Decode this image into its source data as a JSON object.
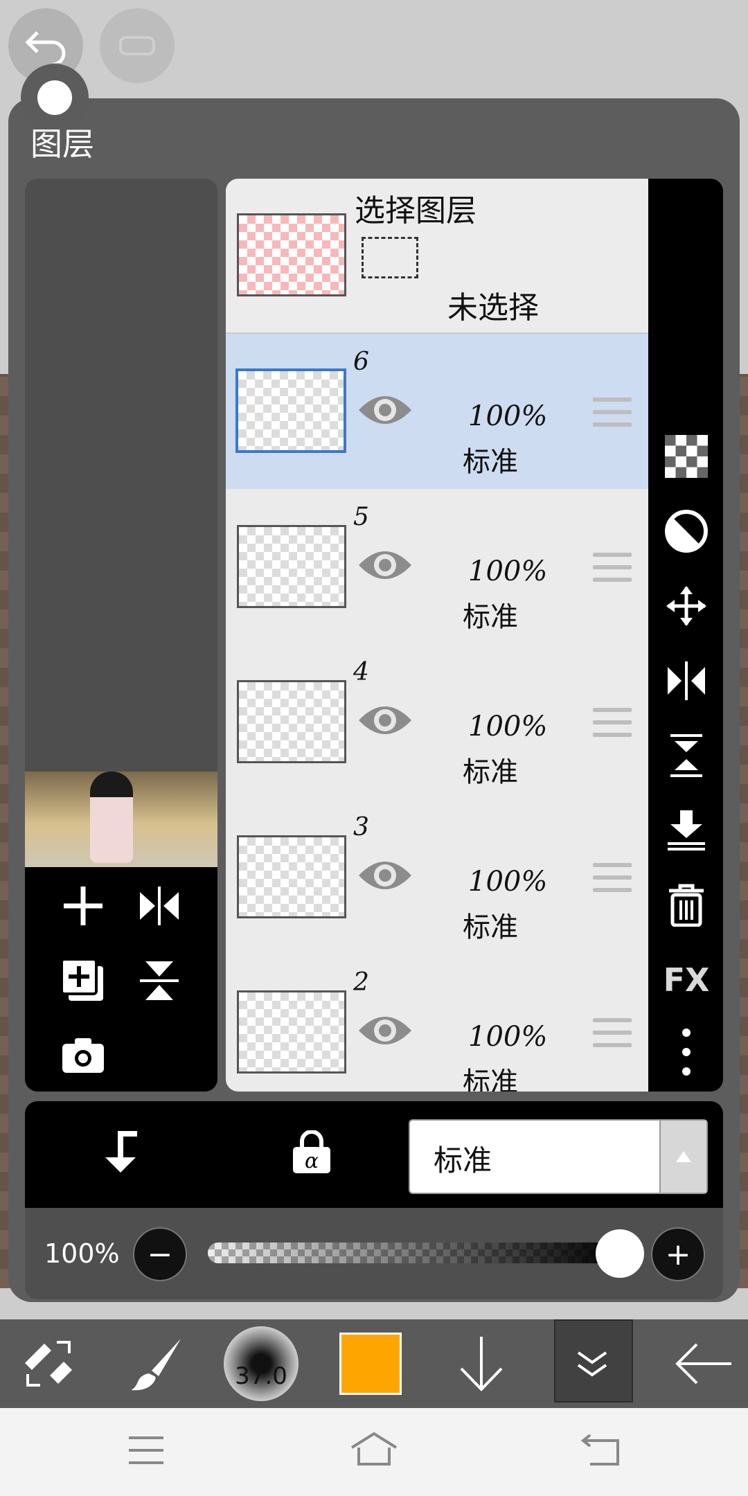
{
  "panel": {
    "title": "图层"
  },
  "selection_row": {
    "title": "选择图层",
    "status": "未选择"
  },
  "layers": [
    {
      "number": "6",
      "opacity": "100%",
      "blend": "标准",
      "selected": true
    },
    {
      "number": "5",
      "opacity": "100%",
      "blend": "标准",
      "selected": false
    },
    {
      "number": "4",
      "opacity": "100%",
      "blend": "标准",
      "selected": false
    },
    {
      "number": "3",
      "opacity": "100%",
      "blend": "标准",
      "selected": false
    },
    {
      "number": "2",
      "opacity": "100%",
      "blend": "标准",
      "selected": false
    }
  ],
  "right_tools": {
    "fx_label": "FX"
  },
  "blend_bar": {
    "mode": "标准"
  },
  "opacity_slider": {
    "label": "100%",
    "value_percent": 100
  },
  "toolbar": {
    "brush_size": "37.0",
    "color": "#ffa500"
  },
  "icons": [
    "undo-icon",
    "redo-icon",
    "add-layer-icon",
    "flip-horizontal-icon",
    "duplicate-layer-icon",
    "flip-vertical-icon",
    "camera-icon",
    "eye-icon",
    "drag-handle-icon",
    "transparency-icon",
    "circle-half-icon",
    "move-icon",
    "flip-horizontal-icon",
    "flip-vertical-icon",
    "merge-down-icon",
    "trash-icon",
    "more-icon",
    "clip-arrow-icon",
    "alpha-lock-icon",
    "swap-icon",
    "brush-icon",
    "down-arrow-icon",
    "collapse-icon",
    "back-arrow-icon",
    "menu-icon",
    "home-icon",
    "return-icon"
  ]
}
